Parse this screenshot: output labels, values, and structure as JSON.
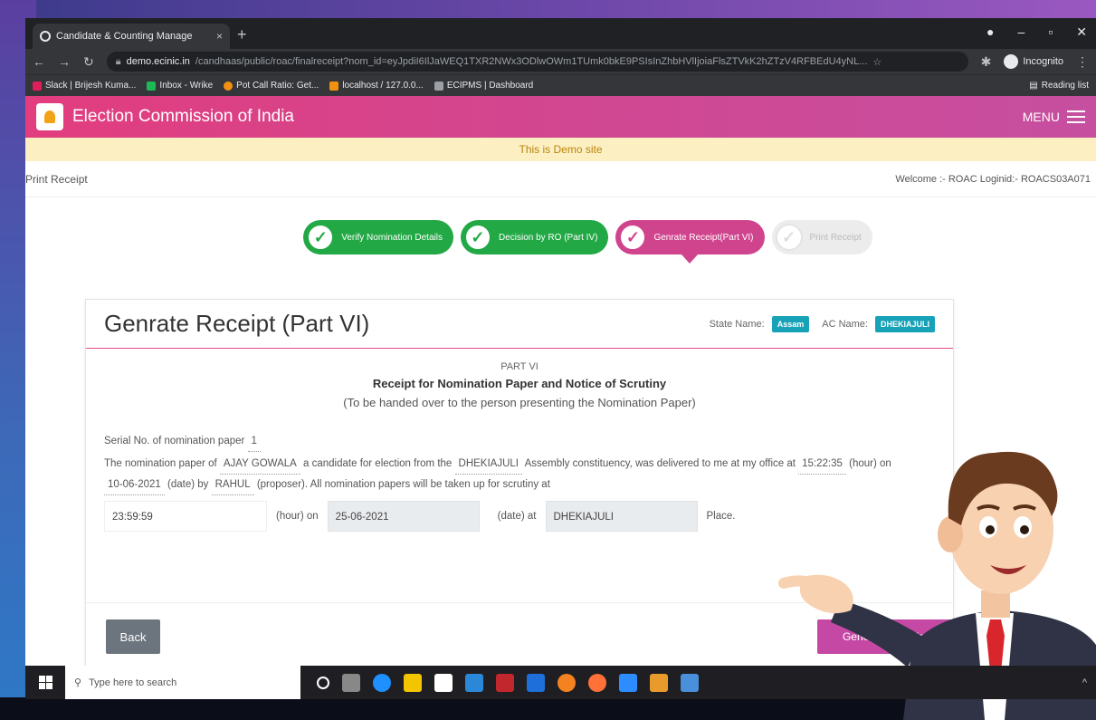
{
  "browser": {
    "tab_title": "Candidate & Counting Manage",
    "tab_close": "×",
    "new_tab": "+",
    "url_host": "demo.ecinic.in",
    "url_path": "/candhaas/public/roac/finalreceipt?nom_id=eyJpdiI6IlJaWEQ1TXR2NWx3ODlwOWm1TUmk0bkE9PSIsInZhbHVlIjoiaFlsZTVkK2hZTzV4RFBEdU4yNL...",
    "incognito_label": "Incognito",
    "bookmarks": [
      {
        "label": "Slack | Brijesh Kuma...",
        "color": "#e01e5a"
      },
      {
        "label": "Inbox - Wrike",
        "color": "#1db954"
      },
      {
        "label": "Pot Call Ratio: Get...",
        "color": "#f29111"
      },
      {
        "label": "localhost / 127.0.0...",
        "color": "#f29111"
      },
      {
        "label": "ECIPMS | Dashboard",
        "color": "#9aa0a6"
      }
    ],
    "reading_list": "Reading list"
  },
  "app": {
    "name": "Election Commission of India",
    "menu_label": "MENU",
    "demo_notice": "This is Demo site",
    "breadcrumb": "Print Receipt",
    "welcome": "Welcome :- ROAC Loginid:- ROACS03A071"
  },
  "stepper": [
    {
      "label": "Verify Nomination Details",
      "state": "done"
    },
    {
      "label": "Decision by RO (Part IV)",
      "state": "done"
    },
    {
      "label": "Genrate Receipt(Part VI)",
      "state": "active"
    },
    {
      "label": "Print Receipt",
      "state": "todo"
    }
  ],
  "card": {
    "title": "Genrate Receipt (Part VI)",
    "state_label": "State Name:",
    "state_value": "Assam",
    "ac_label": "AC Name:",
    "ac_value": "DHEKIAJULI",
    "part_no": "PART VI",
    "part_title": "Receipt for Nomination Paper and Notice of Scrutiny",
    "part_sub": "(To be handed over to the person presenting the Nomination Paper)",
    "serial_label": "Serial No. of nomination paper",
    "serial_value": "1",
    "text1": "The nomination paper of",
    "candidate": "AJAY GOWALA",
    "text2": "a candidate for election from the",
    "constituency": "DHEKIAJULI",
    "text3": "Assembly constituency, was delivered to me at my",
    "text4": "office at",
    "time_delivered": "15:22:35",
    "text5": "(hour) on",
    "date_delivered": "10-06-2021",
    "text6": "(date) by",
    "proposer": "RAHUL",
    "text7": "(proposer). All nomination papers will be taken up for scrutiny at",
    "scrutiny_time": "23:59:59",
    "hour_on": "(hour) on",
    "scrutiny_date": "25-06-2021",
    "date_at": "(date) at",
    "scrutiny_place": "DHEKIAJULI",
    "place_label": "Place.",
    "back_button": "Back",
    "generate_button": "Generate Receipt"
  },
  "taskbar": {
    "search_placeholder": "Type here to search",
    "apps": [
      "#ffffff",
      "#888888",
      "#1e90ff",
      "#f2c500",
      "#ffffff",
      "#2b88d8",
      "#c1272d",
      "#1e6fd9",
      "#f58220",
      "#ff7139",
      "#2d8cff",
      "#e89b2a",
      "#4a8fd9"
    ]
  }
}
